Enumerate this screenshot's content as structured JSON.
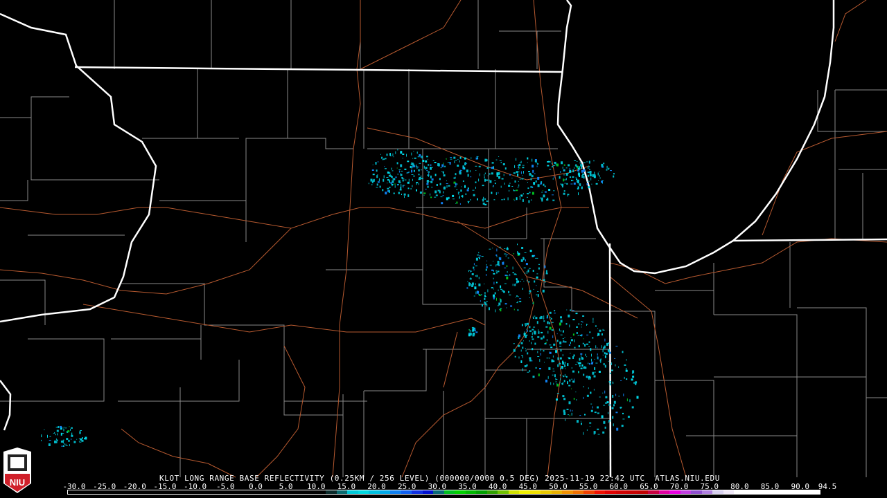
{
  "header": {
    "title": "KLOT LONG RANGE BASE REFLECTIVITY (0.25KM / 256 LEVEL) (000000/0000 0.5 DEG) 2025-11-19 22:42 UTC  ATLAS.NIU.EDU"
  },
  "logo": {
    "text": "NIU",
    "icon": "niu-shield-logo"
  },
  "legend": {
    "unit_min": -30.0,
    "unit_max": 94.5,
    "tick_labels": [
      "-30.0",
      "-25.0",
      "-20.0",
      "-15.0",
      "-10.0",
      "-5.0",
      "0.0",
      "5.0",
      "10.0",
      "15.0",
      "20.0",
      "25.0",
      "30.0",
      "35.0",
      "40.0",
      "45.0",
      "50.0",
      "55.0",
      "60.0",
      "65.0",
      "70.0",
      "75.0",
      "80.0",
      "85.0",
      "90.0",
      "94.5"
    ],
    "colors": [
      "#000000",
      "#000000",
      "#000000",
      "#000000",
      "#000000",
      "#000000",
      "#000000",
      "#000000",
      "#000000",
      "#000000",
      "#000000",
      "#000000",
      "#000000",
      "#000000",
      "#000000",
      "#000000",
      "#000000",
      "#000000",
      "#000000",
      "#000000",
      "#000000",
      "#000000",
      "#000000",
      "#000000",
      "#0a2a2a",
      "#0b6b70",
      "#00c8d8",
      "#00d8e0",
      "#00c0e0",
      "#00a8e8",
      "#1080f0",
      "#1060f0",
      "#1030e0",
      "#0010d0",
      "#0a6a78",
      "#00c020",
      "#00d000",
      "#00b800",
      "#00a000",
      "#30a000",
      "#70c000",
      "#d0e000",
      "#f0f000",
      "#f0e000",
      "#e8c800",
      "#e8b000",
      "#f09000",
      "#f07000",
      "#f04000",
      "#f01000",
      "#e00000",
      "#d00000",
      "#c80000",
      "#c00000",
      "#c80040",
      "#e000a0",
      "#e800e0",
      "#c040e0",
      "#9050d0",
      "#b080e0",
      "#d8d0f0",
      "#f0e8f8",
      "#ffffff",
      "#ffffff",
      "#ffffff",
      "#ffffff",
      "#ffffff",
      "#ffffff",
      "#ffffff",
      "#ffffff"
    ]
  }
}
